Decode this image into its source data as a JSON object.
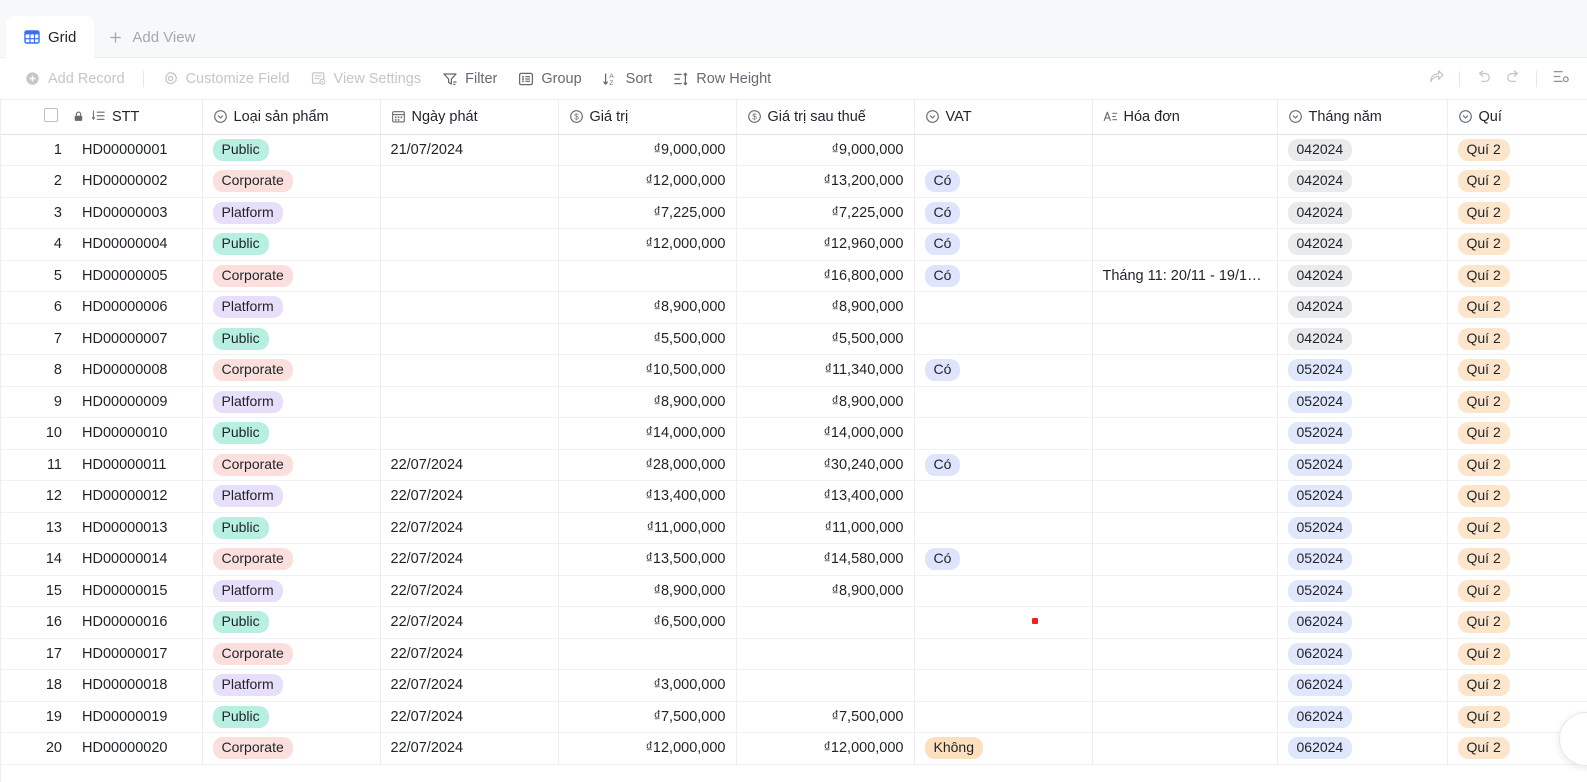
{
  "view_tabs": [
    {
      "label": "Grid",
      "icon": "grid-icon",
      "active": true
    },
    {
      "label": "Add View",
      "icon": "plus-icon",
      "active": false
    }
  ],
  "toolbar": {
    "add_record": "Add Record",
    "customize_field": "Customize Field",
    "view_settings": "View Settings",
    "filter": "Filter",
    "group": "Group",
    "sort": "Sort",
    "row_height": "Row Height",
    "icons": {
      "add_record": "plus-circle-icon",
      "customize_field": "gear-icon",
      "view_settings": "view-settings-icon",
      "filter": "filter-icon",
      "group": "group-icon",
      "sort": "sort-icon",
      "row_height": "row-height-icon",
      "share": "share-icon",
      "undo": "undo-icon",
      "redo": "redo-icon",
      "more": "more-icon"
    }
  },
  "grid": {
    "columns": [
      {
        "key": "idx",
        "label": "",
        "icon": ""
      },
      {
        "key": "stt",
        "label": "STT",
        "icon": "lock-autonumber-icon"
      },
      {
        "key": "loai",
        "label": "Loại sản phẩm",
        "icon": "single-select-icon"
      },
      {
        "key": "ngay",
        "label": "Ngày phát",
        "icon": "date-icon"
      },
      {
        "key": "gia",
        "label": "Giá trị",
        "icon": "currency-icon"
      },
      {
        "key": "giat",
        "label": "Giá trị sau thuế",
        "icon": "currency-icon"
      },
      {
        "key": "vat",
        "label": "VAT",
        "icon": "single-select-icon"
      },
      {
        "key": "hoa",
        "label": "Hóa đơn",
        "icon": "text-icon"
      },
      {
        "key": "thang",
        "label": "Tháng năm",
        "icon": "single-select-icon"
      },
      {
        "key": "qui",
        "label": "Quí",
        "icon": "single-select-icon"
      }
    ],
    "rows": [
      {
        "idx": "1",
        "stt": "HD00000001",
        "loai": "Public",
        "ngay": "21/07/2024",
        "gia": "₫9,000,000",
        "giat": "₫9,000,000",
        "vat": "",
        "hoa": "",
        "thang": "042024",
        "qui": "Quí 2"
      },
      {
        "idx": "2",
        "stt": "HD00000002",
        "loai": "Corporate",
        "ngay": "",
        "gia": "₫12,000,000",
        "giat": "₫13,200,000",
        "vat": "Có",
        "hoa": "",
        "thang": "042024",
        "qui": "Quí 2"
      },
      {
        "idx": "3",
        "stt": "HD00000003",
        "loai": "Platform",
        "ngay": "",
        "gia": "₫7,225,000",
        "giat": "₫7,225,000",
        "vat": "Có",
        "hoa": "",
        "thang": "042024",
        "qui": "Quí 2"
      },
      {
        "idx": "4",
        "stt": "HD00000004",
        "loai": "Public",
        "ngay": "",
        "gia": "₫12,000,000",
        "giat": "₫12,960,000",
        "vat": "Có",
        "hoa": "",
        "thang": "042024",
        "qui": "Quí 2"
      },
      {
        "idx": "5",
        "stt": "HD00000005",
        "loai": "Corporate",
        "ngay": "",
        "gia": "",
        "giat": "₫16,800,000",
        "vat": "Có",
        "hoa": "Tháng 11: 20/11 - 19/1…",
        "thang": "042024",
        "qui": "Quí 2"
      },
      {
        "idx": "6",
        "stt": "HD00000006",
        "loai": "Platform",
        "ngay": "",
        "gia": "₫8,900,000",
        "giat": "₫8,900,000",
        "vat": "",
        "hoa": "",
        "thang": "042024",
        "qui": "Quí 2"
      },
      {
        "idx": "7",
        "stt": "HD00000007",
        "loai": "Public",
        "ngay": "",
        "gia": "₫5,500,000",
        "giat": "₫5,500,000",
        "vat": "",
        "hoa": "",
        "thang": "042024",
        "qui": "Quí 2"
      },
      {
        "idx": "8",
        "stt": "HD00000008",
        "loai": "Corporate",
        "ngay": "",
        "gia": "₫10,500,000",
        "giat": "₫11,340,000",
        "vat": "Có",
        "hoa": "",
        "thang": "052024",
        "qui": "Quí 2"
      },
      {
        "idx": "9",
        "stt": "HD00000009",
        "loai": "Platform",
        "ngay": "",
        "gia": "₫8,900,000",
        "giat": "₫8,900,000",
        "vat": "",
        "hoa": "",
        "thang": "052024",
        "qui": "Quí 2"
      },
      {
        "idx": "10",
        "stt": "HD00000010",
        "loai": "Public",
        "ngay": "",
        "gia": "₫14,000,000",
        "giat": "₫14,000,000",
        "vat": "",
        "hoa": "",
        "thang": "052024",
        "qui": "Quí 2"
      },
      {
        "idx": "11",
        "stt": "HD00000011",
        "loai": "Corporate",
        "ngay": "22/07/2024",
        "gia": "₫28,000,000",
        "giat": "₫30,240,000",
        "vat": "Có",
        "hoa": "",
        "thang": "052024",
        "qui": "Quí 2"
      },
      {
        "idx": "12",
        "stt": "HD00000012",
        "loai": "Platform",
        "ngay": "22/07/2024",
        "gia": "₫13,400,000",
        "giat": "₫13,400,000",
        "vat": "",
        "hoa": "",
        "thang": "052024",
        "qui": "Quí 2"
      },
      {
        "idx": "13",
        "stt": "HD00000013",
        "loai": "Public",
        "ngay": "22/07/2024",
        "gia": "₫11,000,000",
        "giat": "₫11,000,000",
        "vat": "",
        "hoa": "",
        "thang": "052024",
        "qui": "Quí 2"
      },
      {
        "idx": "14",
        "stt": "HD00000014",
        "loai": "Corporate",
        "ngay": "22/07/2024",
        "gia": "₫13,500,000",
        "giat": "₫14,580,000",
        "vat": "Có",
        "hoa": "",
        "thang": "052024",
        "qui": "Quí 2"
      },
      {
        "idx": "15",
        "stt": "HD00000015",
        "loai": "Platform",
        "ngay": "22/07/2024",
        "gia": "₫8,900,000",
        "giat": "₫8,900,000",
        "vat": "",
        "hoa": "",
        "thang": "052024",
        "qui": "Quí 2"
      },
      {
        "idx": "16",
        "stt": "HD00000016",
        "loai": "Public",
        "ngay": "22/07/2024",
        "gia": "₫6,500,000",
        "giat": "",
        "vat": "",
        "hoa": "",
        "thang": "062024",
        "qui": "Quí 2"
      },
      {
        "idx": "17",
        "stt": "HD00000017",
        "loai": "Corporate",
        "ngay": "22/07/2024",
        "gia": "",
        "giat": "",
        "vat": "",
        "hoa": "",
        "thang": "062024",
        "qui": "Quí 2"
      },
      {
        "idx": "18",
        "stt": "HD00000018",
        "loai": "Platform",
        "ngay": "22/07/2024",
        "gia": "₫3,000,000",
        "giat": "",
        "vat": "",
        "hoa": "",
        "thang": "062024",
        "qui": "Quí 2"
      },
      {
        "idx": "19",
        "stt": "HD00000019",
        "loai": "Public",
        "ngay": "22/07/2024",
        "gia": "₫7,500,000",
        "giat": "₫7,500,000",
        "vat": "",
        "hoa": "",
        "thang": "062024",
        "qui": "Quí 2"
      },
      {
        "idx": "20",
        "stt": "HD00000020",
        "loai": "Corporate",
        "ngay": "22/07/2024",
        "gia": "₫12,000,000",
        "giat": "₫12,000,000",
        "vat": "Không",
        "hoa": "",
        "thang": "062024",
        "qui": "Quí 2"
      }
    ]
  },
  "colors": {
    "public": "#b7f0e0",
    "corporate": "#fbdfdc",
    "platform": "#e7def9",
    "co": "#dde4fb",
    "khong": "#fce0bd",
    "month_gray": "#e9eaec",
    "month_blue": "#e0e6fb",
    "qui": "#fde5cb",
    "accent": "#3370ff",
    "marker_red": "#f5221b"
  }
}
